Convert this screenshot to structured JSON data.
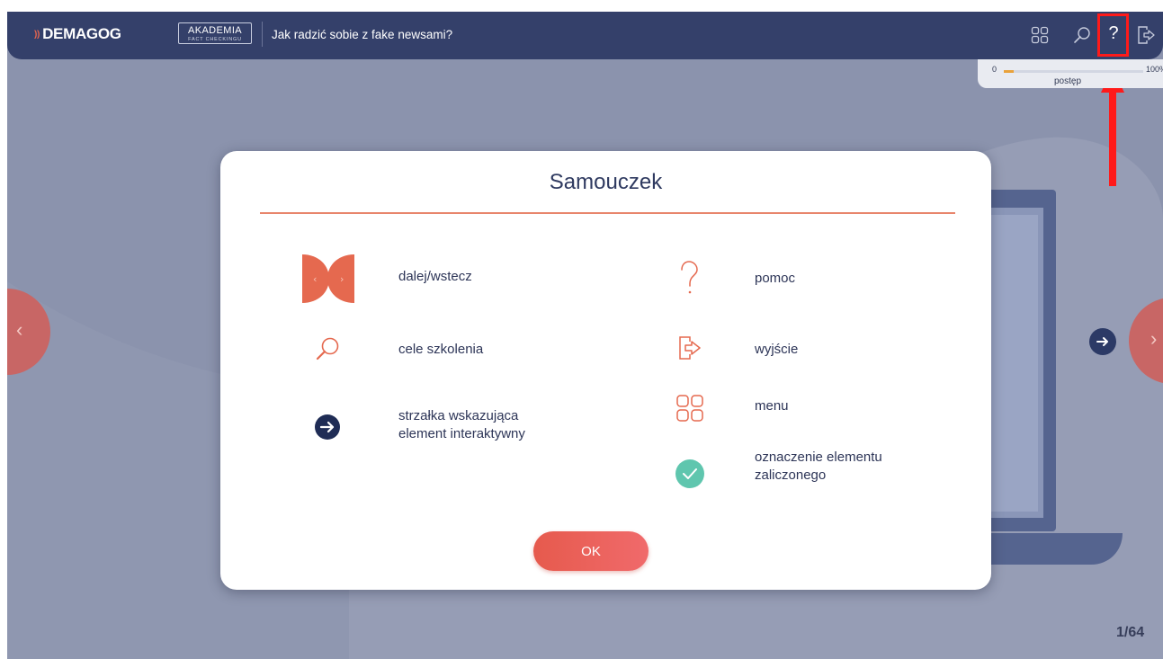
{
  "header": {
    "brand": "DEMAGOG",
    "akademia_main": "AKADEMIA",
    "akademia_sub": "FACT CHECKINGU",
    "course_title": "Jak radzić sobie z fake newsami?",
    "icons": [
      "menu-grid-icon",
      "search-icon",
      "help-icon",
      "exit-icon"
    ],
    "help_glyph": "?"
  },
  "progress": {
    "start_label": "0",
    "end_label": "100%",
    "label": "postęp",
    "value_fraction": 0.07
  },
  "modal": {
    "title": "Samouczek",
    "left_items": [
      {
        "icon": "prev-next-icon",
        "label": "dalej/wstecz"
      },
      {
        "icon": "search-icon",
        "label": "cele szkolenia"
      },
      {
        "icon": "arrow-right-circle-icon",
        "label_line1": "strzałka wskazująca",
        "label_line2": "element interaktywny"
      }
    ],
    "right_items": [
      {
        "icon": "question-icon",
        "label": "pomoc"
      },
      {
        "icon": "exit-icon",
        "label": "wyjście"
      },
      {
        "icon": "menu-grid-icon",
        "label": "menu"
      },
      {
        "icon": "check-circle-icon",
        "label_line1": "oznaczenie elementu",
        "label_line2": "zaliczonego"
      }
    ],
    "ok_label": "OK"
  },
  "page_counter": "1/64",
  "colors": {
    "topbar": "#34406a",
    "background": "#8b93ad",
    "accent": "#e8654e",
    "check": "#5fc6ae",
    "highlight": "#ff1a1a"
  }
}
